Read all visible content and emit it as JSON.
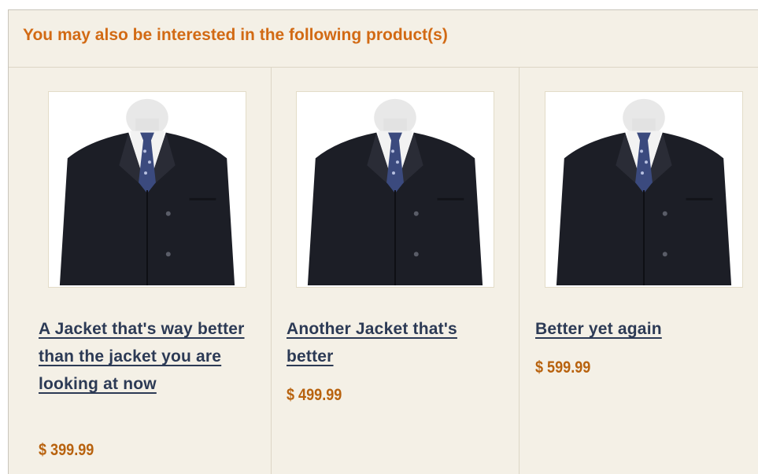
{
  "section": {
    "title": "You may also be interested in the following product(s)"
  },
  "products": [
    {
      "name": "A Jacket that's way better than the jacket you are looking at now",
      "price": "$ 399.99",
      "image_icon": "suit-jacket-icon"
    },
    {
      "name": "Another Jacket that's better",
      "price": "$ 499.99",
      "image_icon": "suit-jacket-icon"
    },
    {
      "name": "Better yet again",
      "price": "$ 599.99",
      "image_icon": "suit-jacket-icon"
    }
  ],
  "colors": {
    "panel_background": "#f4f0e6",
    "title_orange": "#d26a14",
    "link_navy": "#2c3a55",
    "price_orange": "#b8620e"
  }
}
